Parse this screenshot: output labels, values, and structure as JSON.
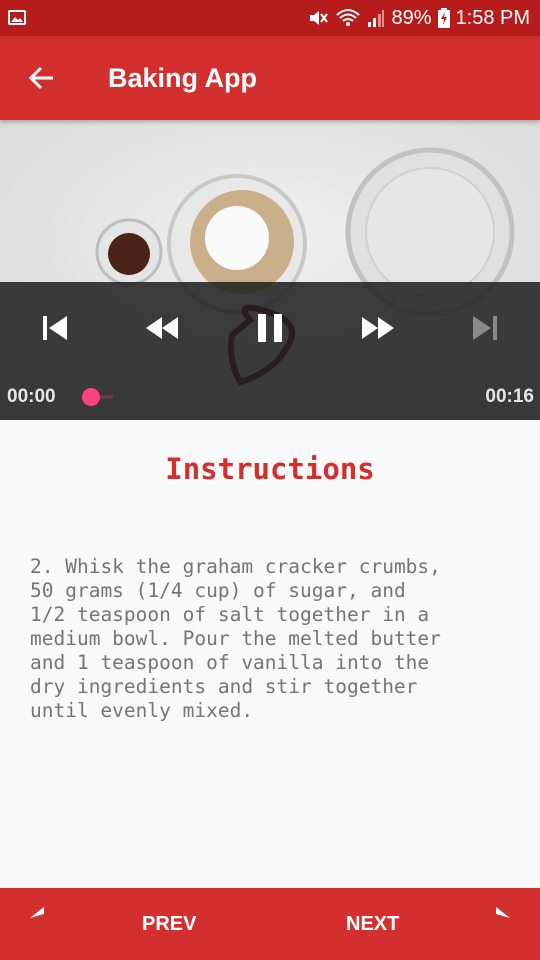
{
  "status_bar": {
    "battery_percent": "89%",
    "time": "1:58 PM"
  },
  "app_bar": {
    "title": "Baking App"
  },
  "player": {
    "position": "00:00",
    "duration": "00:16",
    "progress": 0.0,
    "accent_color": "#ff4081"
  },
  "content": {
    "heading": "Instructions",
    "description": "2. Whisk the graham cracker crumbs,\n50 grams (1/4 cup) of sugar, and\n1/2 teaspoon of salt together in a\nmedium bowl. Pour the melted butter\nand 1 teaspoon of vanilla into the\ndry ingredients and stir together\nuntil evenly mixed."
  },
  "bottom_bar": {
    "prev_label": "PREV",
    "next_label": "NEXT"
  },
  "colors": {
    "primary": "#d32f2f",
    "primary_dark": "#b71c1c"
  }
}
